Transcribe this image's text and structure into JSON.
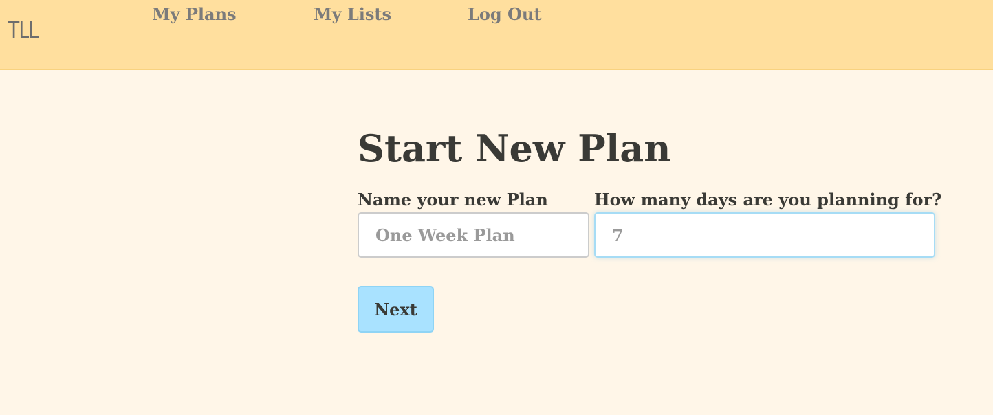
{
  "header": {
    "logo": "TLL",
    "nav": [
      {
        "label": "My Plans"
      },
      {
        "label": "My Lists"
      },
      {
        "label": "Log Out"
      }
    ],
    "background_color": "#ffdf9e"
  },
  "main": {
    "title": "Start New Plan",
    "name_field": {
      "label": "Name your new Plan",
      "placeholder": "One Week Plan",
      "value": ""
    },
    "days_field": {
      "label": "How many days are you planning for?",
      "placeholder": "7",
      "value": "",
      "focused": true
    },
    "next_button": {
      "label": "Next"
    },
    "background_color": "#fff6e8",
    "accent_color": "#a9e2ff"
  }
}
